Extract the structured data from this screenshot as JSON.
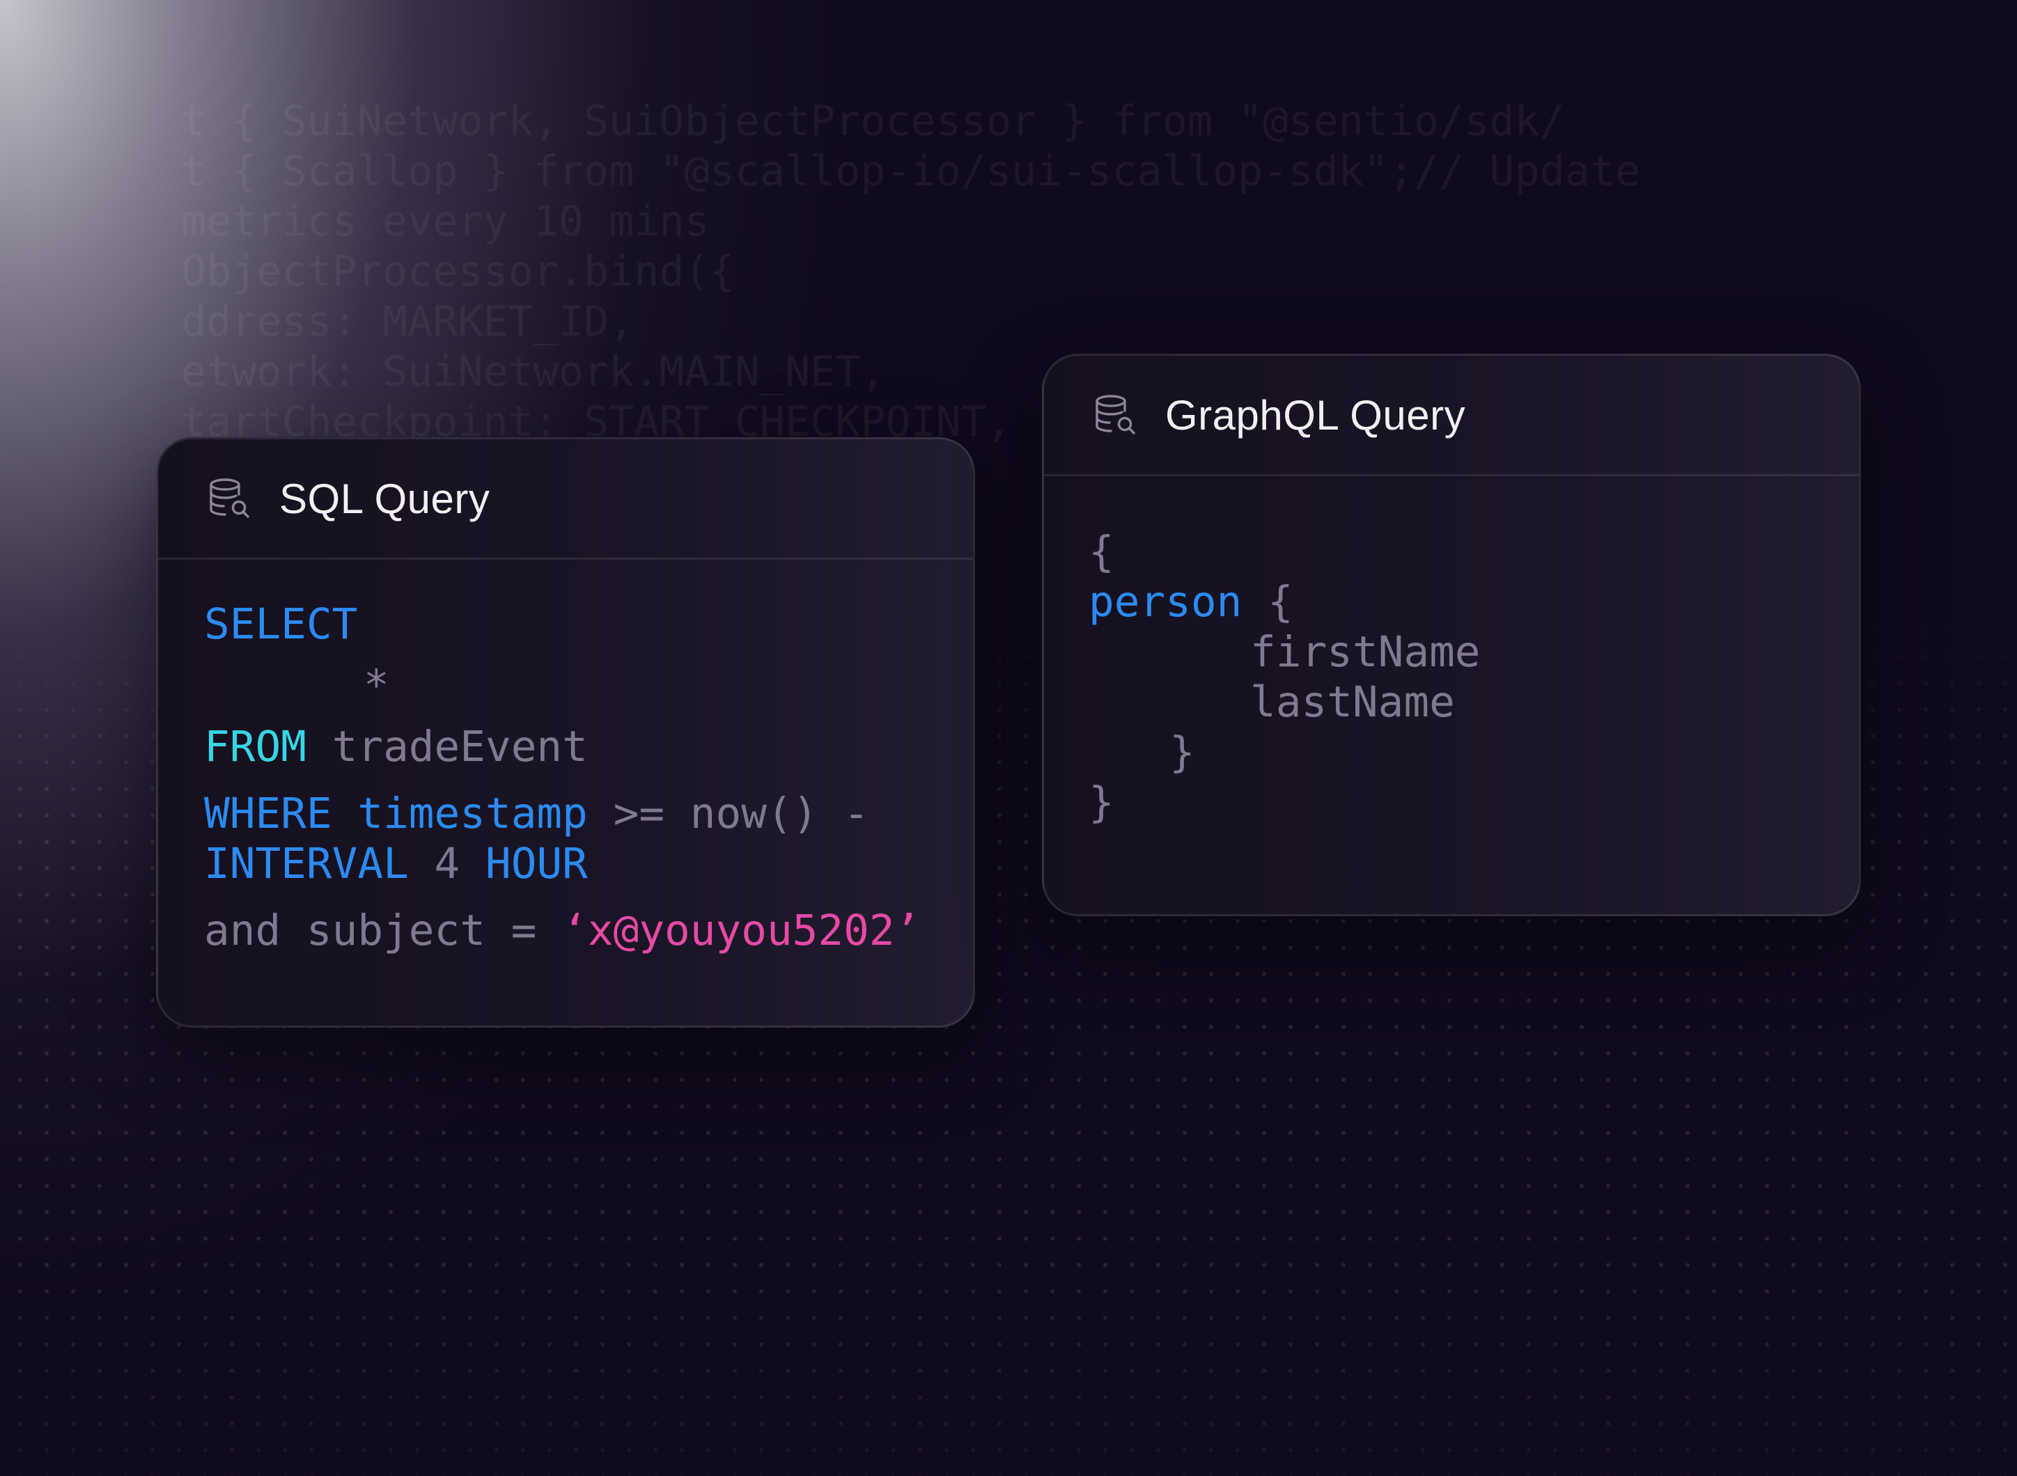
{
  "background": {
    "code_lines": [
      "t { SuiNetwork, SuiObjectProcessor } from \"@sentio/sdk/",
      "t { Scallop } from \"@scallop-io/sui-scallop-sdk\";// Update",
      "metrics every 10 mins",
      "ObjectProcessor.bind({",
      "ddress: MARKET_ID,",
      "etwork: SuiNetwork.MAIN_NET,",
      "tartCheckpoint: START_CHECKPOINT,"
    ]
  },
  "sql_card": {
    "title": "SQL Query",
    "icon": "database-search-icon",
    "code": {
      "line1": {
        "kw": "SELECT"
      },
      "line2": {
        "text": "*"
      },
      "line3": {
        "kw": "FROM",
        "rest": " tradeEvent"
      },
      "line4": {
        "kw": "WHERE timestamp",
        "rest": " >= now() -"
      },
      "line5": {
        "kw1": "INTERVAL",
        "num": " 4 ",
        "kw2": "HOUR"
      },
      "line6": {
        "rest": "and subject = ",
        "str": "‘x@youyou5202’"
      }
    }
  },
  "graphql_card": {
    "title": "GraphQL Query",
    "icon": "database-search-icon",
    "code": {
      "line1": "{",
      "line2": {
        "kw": "person",
        "rest": " {"
      },
      "line3": "firstName",
      "line4": "lastName",
      "line5": "}",
      "line6": "}"
    }
  },
  "colors": {
    "background": "#100a1d",
    "keyword_blue": "#2b8bf2",
    "keyword_cyan": "#35d6e6",
    "string_pink": "#e64aa4",
    "muted_text": "#7f7a8c",
    "title_text": "#f2f0f5"
  }
}
